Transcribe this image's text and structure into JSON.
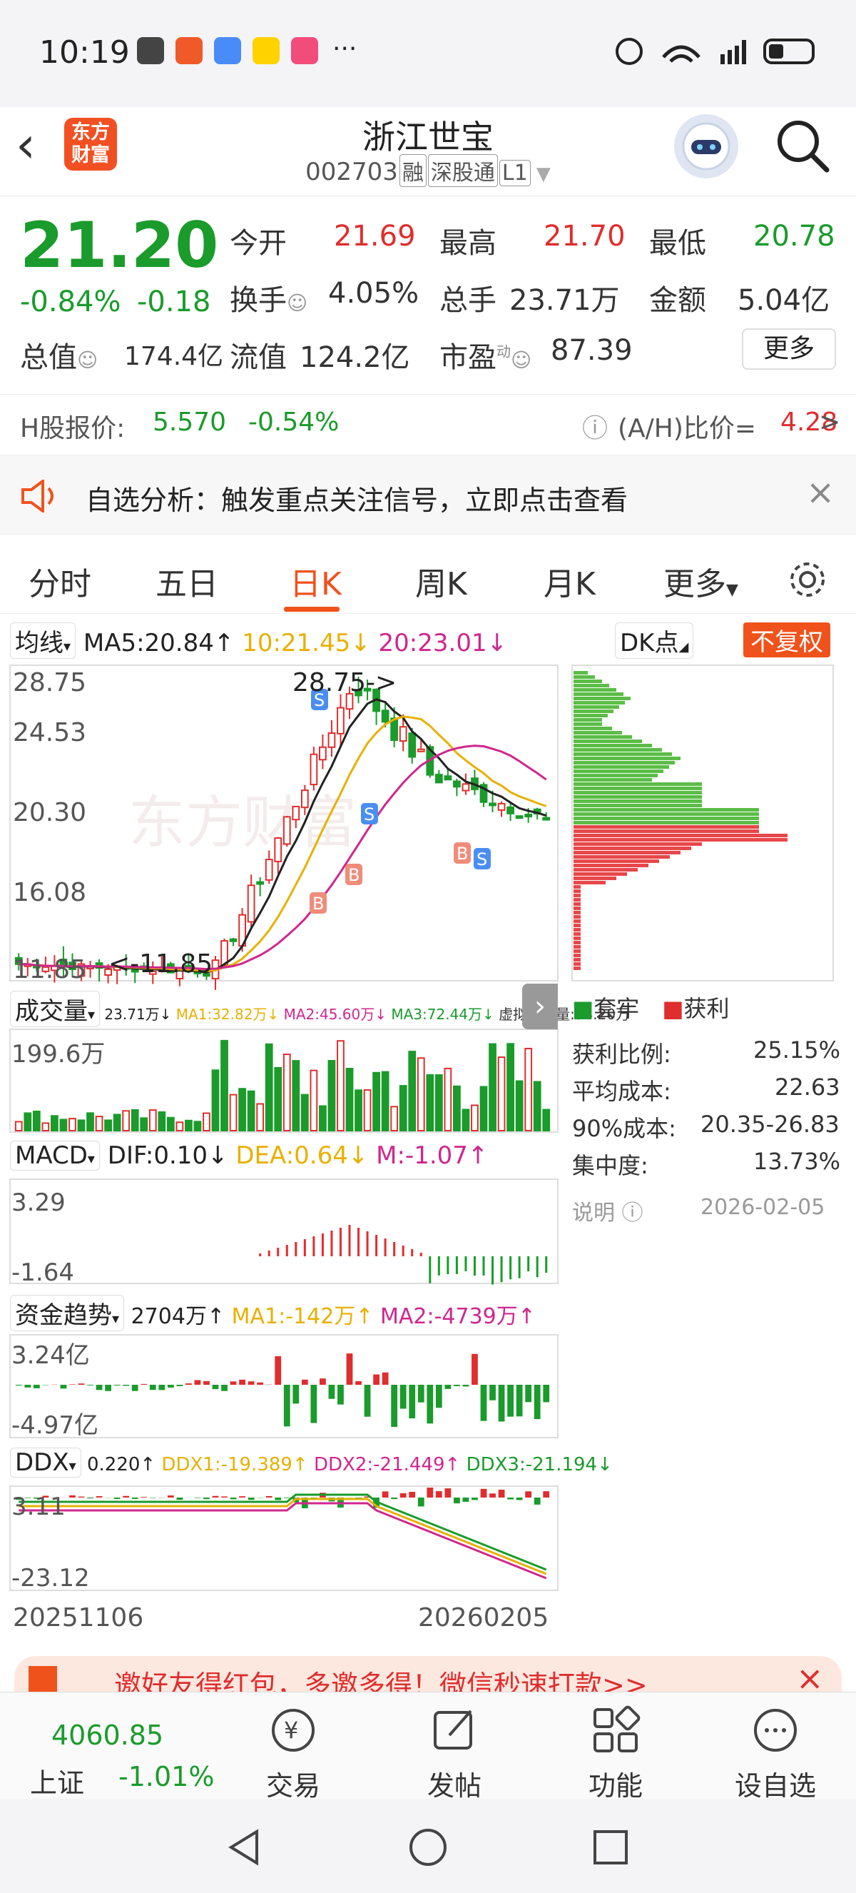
{
  "status": {
    "time": "10:19",
    "dots": "···",
    "network": "5G"
  },
  "header": {
    "logo_line1": "东方",
    "logo_line2": "财富",
    "name": "浙江世宝",
    "code": "002703",
    "tag1": "融",
    "tag2": "深股通",
    "tag3": "L1"
  },
  "quote": {
    "price": "21.20",
    "change_pct": "-0.84%",
    "change": "-0.18",
    "open_label": "今开",
    "open": "21.69",
    "high_label": "最高",
    "high": "21.70",
    "low_label": "最低",
    "low": "20.78",
    "turnover_label": "换手",
    "turnover": "4.05%",
    "volume_label": "总手",
    "volume": "23.71万",
    "amount_label": "金额",
    "amount": "5.04亿",
    "mcap_label": "总值",
    "mcap": "174.4亿",
    "float_label": "流值",
    "float": "124.2亿",
    "pe_label": "市盈",
    "pe_sup": "动",
    "pe": "87.39",
    "more": "更多"
  },
  "hshare": {
    "label": "H股报价:",
    "price": "5.570",
    "pct": "-0.54%",
    "ratio_label": "(A/H)比价=",
    "ratio": "4.28",
    "arrow": ">"
  },
  "notice": {
    "text": "自选分析：触发重点关注信号，立即点击查看",
    "close": "×"
  },
  "tabs": [
    "分时",
    "五日",
    "日K",
    "周K",
    "月K",
    "更多"
  ],
  "ma": {
    "sel": "均线",
    "ma5": "MA5:20.84↑",
    "ma10": "10:21.45↓",
    "ma20": "20:23.01↓",
    "dk": "DK点",
    "fq": "不复权"
  },
  "axis": {
    "y1": "28.75",
    "y2": "24.53",
    "y3": "20.30",
    "y4": "16.08",
    "y5": "11.85",
    "high_tag": "28.75->",
    "low_tag": "<-11.85",
    "watermark": "东方财富"
  },
  "vol": {
    "sel": "成交量",
    "vals": "23.71万↓",
    "ma1": "MA1:32.82万↓",
    "ma2": "MA2:45.60万↓",
    "ma3": "MA3:72.44万↓",
    "virt": "虚拟成交量:54.20万",
    "max": "199.6万"
  },
  "macd": {
    "sel": "MACD",
    "dif": "DIF:0.10↓",
    "dea": "DEA:0.64↓",
    "m": "M:-1.07↑",
    "top": "3.29",
    "bot": "-1.64"
  },
  "fund": {
    "sel": "资金趋势",
    "v": "2704万↑",
    "ma1": "MA1:-142万↑",
    "ma2": "MA2:-4739万↑",
    "top": "3.24亿",
    "bot": "-4.97亿"
  },
  "ddx": {
    "sel": "DDX",
    "v": "0.220↑",
    "d1": "DDX1:-19.389↑",
    "d2": "DDX2:-21.449↑",
    "d3": "DDX3:-21.194↓",
    "top": "3.11",
    "bot": "-23.12"
  },
  "dates": {
    "start": "20251106",
    "end": "20260205"
  },
  "chip": {
    "legend_loss": "套牢",
    "legend_gain": "获利",
    "profit_label": "获利比例:",
    "profit": "25.15%",
    "avg_label": "平均成本:",
    "avg": "22.63",
    "c90_label": "90%成本:",
    "c90": "20.35-26.83",
    "conc_label": "集中度:",
    "conc": "13.73%",
    "note": "说明",
    "date": "2026-02-05"
  },
  "banner": {
    "text": "邀好友得红包，多邀多得！微信秒速打款>>"
  },
  "bottom": {
    "index_value": "4060.85",
    "index_name": "上证",
    "index_pct": "-1.01%",
    "trade": "交易",
    "post": "发帖",
    "func": "功能",
    "watch": "设自选"
  },
  "colors": {
    "up": "#e02d2d",
    "down": "#1a9b2b",
    "accent": "#f0521c"
  }
}
